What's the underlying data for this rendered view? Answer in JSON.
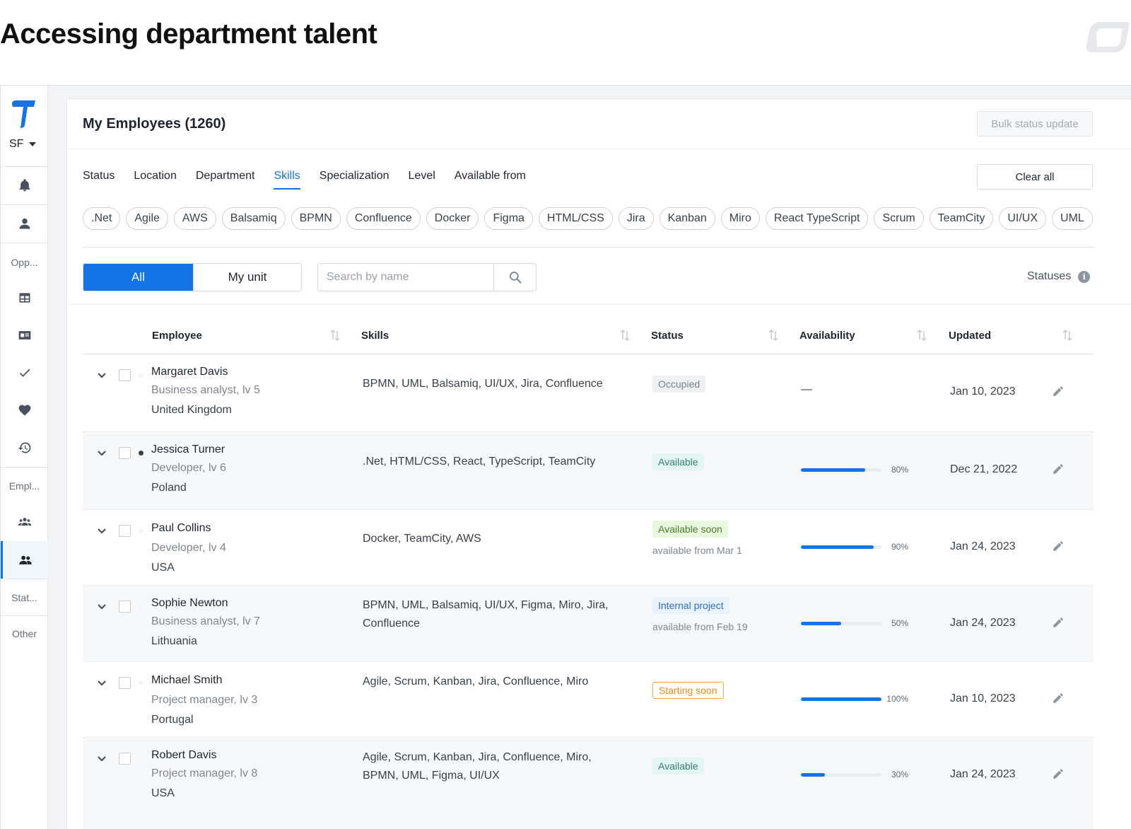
{
  "page": {
    "title": "Accessing department talent"
  },
  "sidebar": {
    "org": "SF",
    "sections": {
      "opportunities": "Opp...",
      "employees": "Empl...",
      "statistics": "Stat...",
      "other": "Other"
    },
    "icons": [
      "bell-icon",
      "person-icon",
      "table-icon",
      "id-card-icon",
      "check-icon",
      "heart-icon",
      "history-icon",
      "team-icon",
      "people-icon"
    ]
  },
  "card": {
    "title": "My Employees (1260)",
    "bulk_label": "Bulk status update",
    "clear_label": "Clear all"
  },
  "filter_tabs": [
    "Status",
    "Location",
    "Department",
    "Skills",
    "Specialization",
    "Level",
    "Available from"
  ],
  "active_filter": "Skills",
  "skill_chips": [
    ".Net",
    "Agile",
    "AWS",
    "Balsamiq",
    "BPMN",
    "Confluence",
    "Docker",
    "Figma",
    "HTML/CSS",
    "Jira",
    "Kanban",
    "Miro",
    "React TypeScript",
    "Scrum",
    "TeamCity",
    "UI/UX",
    "UML"
  ],
  "segment": {
    "all": "All",
    "my_unit": "My unit",
    "selected": "All"
  },
  "search": {
    "placeholder": "Search by name",
    "value": ""
  },
  "statuses_label": "Statuses",
  "table": {
    "columns": {
      "employee": "Employee",
      "skills": "Skills",
      "status": "Status",
      "availability": "Availability",
      "updated": "Updated"
    },
    "rows": [
      {
        "name": "Margaret Davis",
        "role": "Business analyst, lv 5",
        "location": "United Kingdom",
        "skills": "BPMN, UML, Balsamiq, UI/UX, Jira, Confluence",
        "status": "Occupied",
        "status_note": "",
        "availability": "—",
        "availability_pct": null,
        "updated": "Jan 10, 2023",
        "online": false
      },
      {
        "name": "Jessica Turner",
        "role": "Developer, lv 6",
        "location": "Poland",
        "skills": ".Net, HTML/CSS, React, TypeScript, TeamCity",
        "status": "Available",
        "status_note": "",
        "availability": "80%",
        "availability_pct": 80,
        "updated": "Dec 21, 2022",
        "online": true
      },
      {
        "name": "Paul Collins",
        "role": "Developer, lv 4",
        "location": "USA",
        "skills": "Docker, TeamCity, AWS",
        "status": "Available soon",
        "status_note": "available from Mar 1",
        "availability": "90%",
        "availability_pct": 90,
        "updated": "Jan 24, 2023",
        "online": false
      },
      {
        "name": "Sophie Newton",
        "role": "Business analyst, lv 7",
        "location": "Lithuania",
        "skills": "BPMN, UML, Balsamiq, UI/UX, Figma, Miro, Jira, Confluence",
        "status": "Internal project",
        "status_note": "available from Feb 19",
        "availability": "50%",
        "availability_pct": 50,
        "updated": "Jan 24, 2023",
        "online": false
      },
      {
        "name": "Michael Smith",
        "role": "Project manager, lv 3",
        "location": "Portugal",
        "skills": "Agile, Scrum, Kanban, Jira, Confluence, Miro",
        "status": "Starting soon",
        "status_note": "",
        "availability": "100%",
        "availability_pct": 100,
        "updated": "Jan 10, 2023",
        "online": false
      },
      {
        "name": "Robert Davis",
        "role": "Project manager, lv 8",
        "location": "USA",
        "skills": "Agile, Scrum, Kanban, Jira, Confluence, Miro, BPMN, UML, Figma, UI/UX",
        "status": "Available",
        "status_note": "",
        "availability": "30%",
        "availability_pct": 30,
        "updated": "Jan 24, 2023",
        "online": false
      }
    ]
  },
  "colors": {
    "accent": "#1473e6",
    "starting_soon": "#ef8a17",
    "available_soon": "#4c7a2c"
  }
}
